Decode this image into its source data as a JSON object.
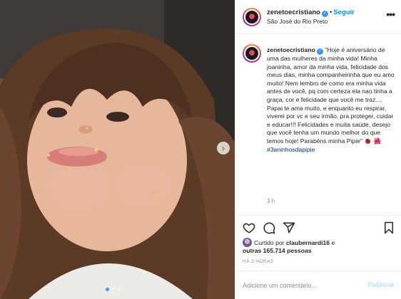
{
  "post": {
    "username": "zenetoecristiano",
    "verified_mark": "✓",
    "separator": "•",
    "follow_label": "Seguir",
    "location": "São José do Rio Preto",
    "more_icon": "more-dots-icon",
    "more_glyph": "•••"
  },
  "caption": {
    "username": "zenetoecristiano",
    "verified_mark": "✓",
    "text": "\"Hoje é aniversário de uma das mulheres da minha vida! Minha joaninha, amor da minha vida, felicidade dos meus dias, minha companheirinha que eu amo muito! Nem lembro de como era minha vida antes de você, pq com certeza ela nao tinha a graça, cor e felicidade que você me traz.... Papai te ama muito, e enquanto eu respirar, viverei por vc e seu irmão, pra proteger, cuidar e educar!!! Felicidades e muita saúde, desejo que você tenha um mundo melhor do que temos hoje! Parabéns minha Pipie\"",
    "emoji_1": "🐞",
    "emoji_2": "🌺",
    "hashtag": "#3aninhosdapipie",
    "time_ago": "3 h"
  },
  "actions": {
    "like_icon": "heart-icon",
    "comment_icon": "comment-icon",
    "share_icon": "paper-plane-icon",
    "save_icon": "bookmark-icon"
  },
  "likes": {
    "prefix": "Curtido por",
    "user": "claubernardi16",
    "connector": "e",
    "others": "outras 165.714 pessoas"
  },
  "timestamp": "HÁ 3 HORAS",
  "comment": {
    "placeholder": "Adicione um comentário...",
    "publish_label": "Publicar"
  },
  "carousel": {
    "next_glyph": "›",
    "total_slides": 3,
    "active_slide": 1
  },
  "colors": {
    "accent": "#0095f6",
    "verified": "#3897f0",
    "hashtag": "#00376b",
    "muted": "#8e8e8e",
    "publish_disabled": "#b2dffc"
  }
}
